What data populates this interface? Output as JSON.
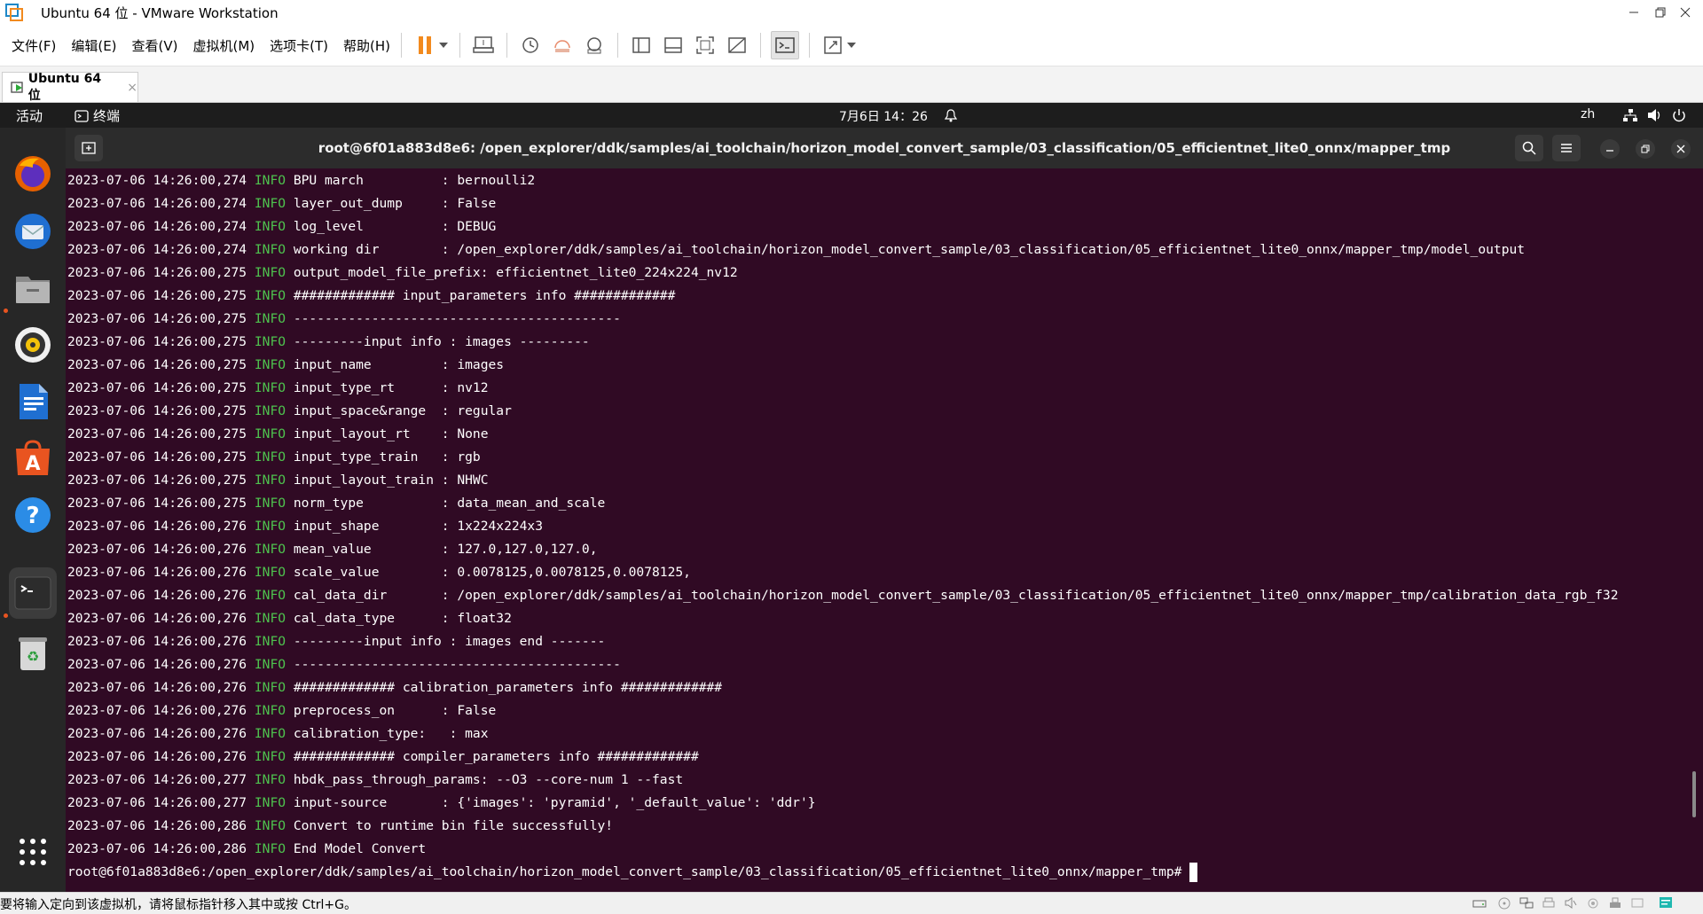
{
  "window": {
    "title": "Ubuntu 64 位 - VMware Workstation",
    "controls": [
      "minimize",
      "restore",
      "close"
    ]
  },
  "menu": {
    "items": [
      "文件(F)",
      "编辑(E)",
      "查看(V)",
      "虚拟机(M)",
      "选项卡(T)",
      "帮助(H)"
    ]
  },
  "toolbar": {
    "icons": [
      "pause-icon",
      "dropdown-icon",
      "send-ctrl-alt-del-icon",
      "snapshot-icon",
      "revert-snapshot-icon",
      "snapshot-manager-icon",
      "show-library-icon",
      "thumbnail-bar-icon",
      "full-screen-icon",
      "unity-icon",
      "console-view-icon",
      "stretch-guest-icon",
      "stretch-dropdown-icon"
    ]
  },
  "tabs": [
    {
      "label": "Ubuntu 64 位",
      "close": "×"
    }
  ],
  "gnome": {
    "activities": "活动",
    "app": "终端",
    "clock": "7月6日  14：26",
    "input_method": "zh"
  },
  "dock": {
    "apps": [
      "firefox-icon",
      "thunderbird-icon",
      "files-icon",
      "rhythmbox-icon",
      "libreoffice-writer-icon",
      "app-store-icon",
      "help-icon",
      "terminal-icon",
      "trash-icon",
      "show-apps-icon"
    ]
  },
  "terminal": {
    "title": "root@6f01a883d8e6: /open_explorer/ddk/samples/ai_toolchain/horizon_model_convert_sample/03_classification/05_efficientnet_lite0_onnx/mapper_tmp",
    "lines": [
      {
        "time": "2023-07-06 14:26:00,274",
        "level": "INFO",
        "msg": "BPU march          : bernoulli2"
      },
      {
        "time": "2023-07-06 14:26:00,274",
        "level": "INFO",
        "msg": "layer_out_dump     : False"
      },
      {
        "time": "2023-07-06 14:26:00,274",
        "level": "INFO",
        "msg": "log_level          : DEBUG"
      },
      {
        "time": "2023-07-06 14:26:00,274",
        "level": "INFO",
        "msg": "working dir        : /open_explorer/ddk/samples/ai_toolchain/horizon_model_convert_sample/03_classification/05_efficientnet_lite0_onnx/mapper_tmp/model_output"
      },
      {
        "time": "2023-07-06 14:26:00,275",
        "level": "INFO",
        "msg": "output_model_file_prefix: efficientnet_lite0_224x224_nv12"
      },
      {
        "time": "2023-07-06 14:26:00,275",
        "level": "INFO",
        "msg": "############# input_parameters info #############"
      },
      {
        "time": "2023-07-06 14:26:00,275",
        "level": "INFO",
        "msg": "------------------------------------------"
      },
      {
        "time": "2023-07-06 14:26:00,275",
        "level": "INFO",
        "msg": "---------input info : images ---------"
      },
      {
        "time": "2023-07-06 14:26:00,275",
        "level": "INFO",
        "msg": "input_name         : images"
      },
      {
        "time": "2023-07-06 14:26:00,275",
        "level": "INFO",
        "msg": "input_type_rt      : nv12"
      },
      {
        "time": "2023-07-06 14:26:00,275",
        "level": "INFO",
        "msg": "input_space&range  : regular"
      },
      {
        "time": "2023-07-06 14:26:00,275",
        "level": "INFO",
        "msg": "input_layout_rt    : None"
      },
      {
        "time": "2023-07-06 14:26:00,275",
        "level": "INFO",
        "msg": "input_type_train   : rgb"
      },
      {
        "time": "2023-07-06 14:26:00,275",
        "level": "INFO",
        "msg": "input_layout_train : NHWC"
      },
      {
        "time": "2023-07-06 14:26:00,275",
        "level": "INFO",
        "msg": "norm_type          : data_mean_and_scale"
      },
      {
        "time": "2023-07-06 14:26:00,276",
        "level": "INFO",
        "msg": "input_shape        : 1x224x224x3"
      },
      {
        "time": "2023-07-06 14:26:00,276",
        "level": "INFO",
        "msg": "mean_value         : 127.0,127.0,127.0,"
      },
      {
        "time": "2023-07-06 14:26:00,276",
        "level": "INFO",
        "msg": "scale_value        : 0.0078125,0.0078125,0.0078125,"
      },
      {
        "time": "2023-07-06 14:26:00,276",
        "level": "INFO",
        "msg": "cal_data_dir       : /open_explorer/ddk/samples/ai_toolchain/horizon_model_convert_sample/03_classification/05_efficientnet_lite0_onnx/mapper_tmp/calibration_data_rgb_f32"
      },
      {
        "time": "2023-07-06 14:26:00,276",
        "level": "INFO",
        "msg": "cal_data_type      : float32"
      },
      {
        "time": "2023-07-06 14:26:00,276",
        "level": "INFO",
        "msg": "---------input info : images end -------"
      },
      {
        "time": "2023-07-06 14:26:00,276",
        "level": "INFO",
        "msg": "------------------------------------------"
      },
      {
        "time": "2023-07-06 14:26:00,276",
        "level": "INFO",
        "msg": "############# calibration_parameters info #############"
      },
      {
        "time": "2023-07-06 14:26:00,276",
        "level": "INFO",
        "msg": "preprocess_on      : False"
      },
      {
        "time": "2023-07-06 14:26:00,276",
        "level": "INFO",
        "msg": "calibration_type:   : max"
      },
      {
        "time": "2023-07-06 14:26:00,276",
        "level": "INFO",
        "msg": "############# compiler_parameters info #############"
      },
      {
        "time": "2023-07-06 14:26:00,277",
        "level": "INFO",
        "msg": "hbdk_pass_through_params: --O3 --core-num 1 --fast"
      },
      {
        "time": "2023-07-06 14:26:00,277",
        "level": "INFO",
        "msg": "input-source       : {'images': 'pyramid', '_default_value': 'ddr'}"
      },
      {
        "time": "2023-07-06 14:26:00,286",
        "level": "INFO",
        "msg": "Convert to runtime bin file successfully!"
      },
      {
        "time": "2023-07-06 14:26:00,286",
        "level": "INFO",
        "msg": "End Model Convert"
      }
    ],
    "prompt": "root@6f01a883d8e6:/open_explorer/ddk/samples/ai_toolchain/horizon_model_convert_sample/03_classification/05_efficientnet_lite0_onnx/mapper_tmp# "
  },
  "status": {
    "message": "要将输入定向到该虚拟机，请将鼠标指针移入其中或按 Ctrl+G。"
  },
  "colors": {
    "terminal_bg": "#300a24",
    "info_level": "#4ec24e",
    "pause_accent": "#f28a1e"
  }
}
